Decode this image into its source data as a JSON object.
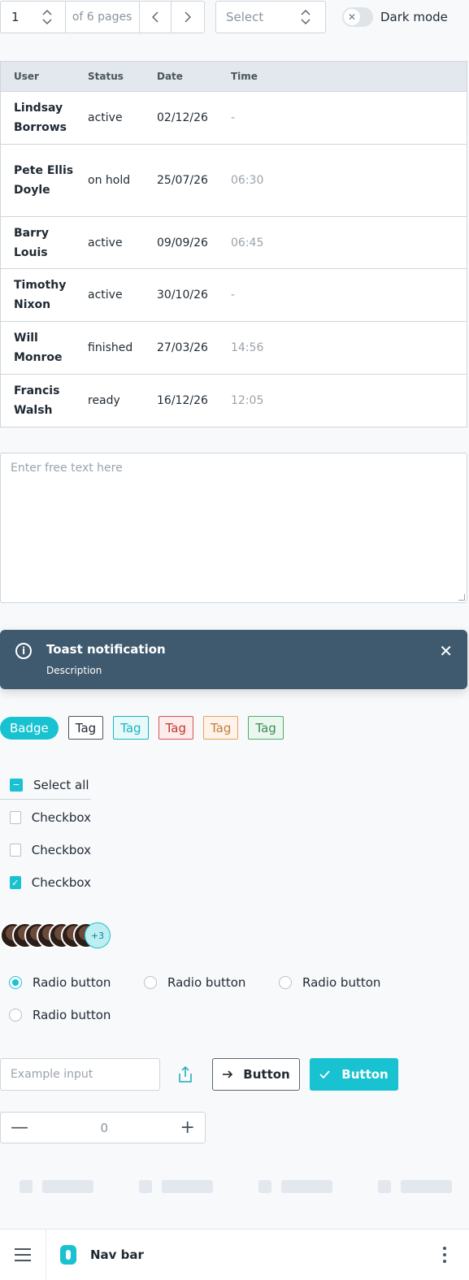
{
  "pagination": {
    "page": "1",
    "of_label": "of 6 pages"
  },
  "select": {
    "placeholder": "Select"
  },
  "dark_mode": {
    "label": "Dark mode",
    "enabled": false
  },
  "table": {
    "columns": [
      "User",
      "Status",
      "Date",
      "Time"
    ],
    "rows": [
      {
        "user": "Lindsay Borrows",
        "status": "active",
        "date": "02/12/26",
        "time": "-"
      },
      {
        "user": "Pete Ellis Doyle",
        "status": "on hold",
        "date": "25/07/26",
        "time": "06:30"
      },
      {
        "user": "Barry Louis",
        "status": "active",
        "date": "09/09/26",
        "time": "06:45"
      },
      {
        "user": "Timothy Nixon",
        "status": "active",
        "date": "30/10/26",
        "time": "-"
      },
      {
        "user": "Will Monroe",
        "status": "finished",
        "date": "27/03/26",
        "time": "14:56"
      },
      {
        "user": "Francis Walsh",
        "status": "ready",
        "date": "16/12/26",
        "time": "12:05"
      }
    ]
  },
  "textarea": {
    "placeholder": "Enter free text here"
  },
  "toast": {
    "title": "Toast notification",
    "description": "Description"
  },
  "badges": {
    "badge": "Badge",
    "tags": [
      {
        "label": "Tag",
        "color": "#4a555e"
      },
      {
        "label": "Tag",
        "color": "#19b5c2"
      },
      {
        "label": "Tag",
        "color": "#d9534f"
      },
      {
        "label": "Tag",
        "color": "#e8a05c"
      },
      {
        "label": "Tag",
        "color": "#4caf6e"
      }
    ]
  },
  "checkboxes": {
    "select_all": "Select all",
    "items": [
      {
        "label": "Checkbox",
        "checked": false
      },
      {
        "label": "Checkbox",
        "checked": false
      },
      {
        "label": "Checkbox",
        "checked": true
      }
    ]
  },
  "avatars": {
    "more_count": "+3"
  },
  "radios": {
    "items": [
      {
        "label": "Radio button",
        "selected": true
      },
      {
        "label": "Radio button",
        "selected": false
      },
      {
        "label": "Radio button",
        "selected": false
      },
      {
        "label": "Radio button",
        "selected": false
      }
    ]
  },
  "form": {
    "input_placeholder": "Example input",
    "outline_button": "Button",
    "primary_button": "Button"
  },
  "number_stepper": {
    "value": "0"
  },
  "navbar": {
    "title": "Nav bar"
  },
  "colors": {
    "accent": "#19c2d0",
    "toast_bg": "#3f5a6e",
    "header_bg": "#e2e8ed"
  }
}
